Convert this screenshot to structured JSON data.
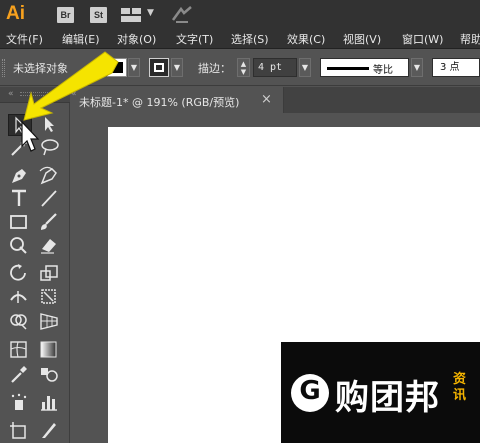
{
  "appbar": {
    "app_logo": "Ai",
    "bridge_badge": "Br",
    "stock_badge": "St"
  },
  "menu": {
    "items": [
      "文件(F)",
      "编辑(E)",
      "对象(O)",
      "文字(T)",
      "选择(S)",
      "效果(C)",
      "视图(V)",
      "窗口(W)",
      "帮助"
    ]
  },
  "control": {
    "selection_status": "未选择对象",
    "stroke_label": "描边：",
    "stroke_weight": "4 pt",
    "profile_label": "等比",
    "brush_value": "3 点"
  },
  "document": {
    "tab_title": "未标题-1* @ 191% (RGB/预览)",
    "close_glyph": "×"
  },
  "watermark": {
    "logo_letter": "G",
    "brand": "购团邦",
    "side_text": "资讯"
  },
  "colors": {
    "accent": "#f7a11e",
    "pointer": "#f5e400"
  }
}
